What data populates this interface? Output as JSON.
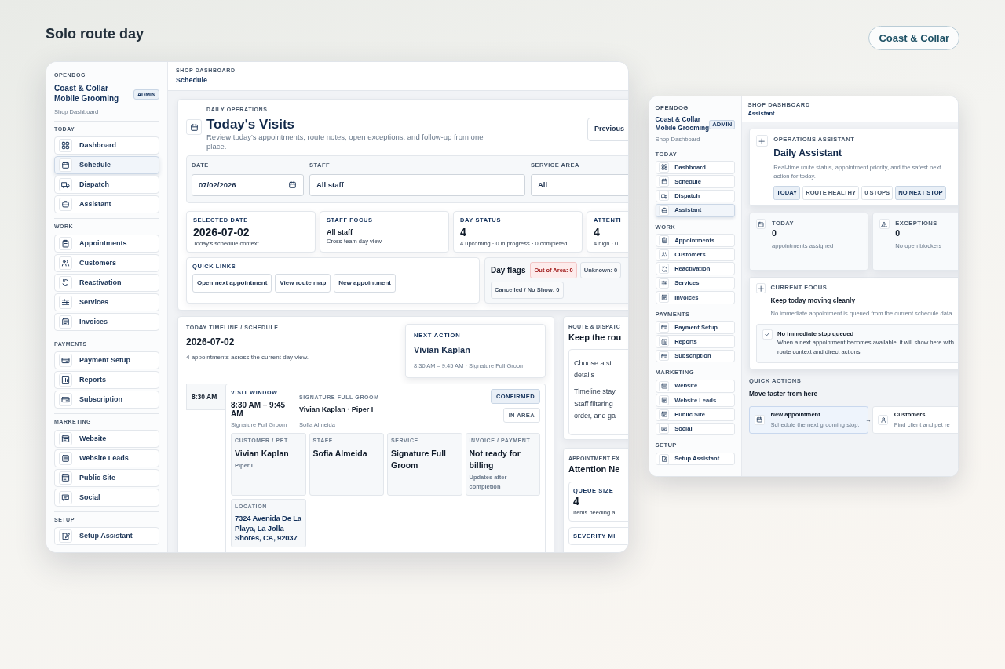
{
  "page": {
    "title": "Solo route day",
    "brand_button": "Coast & Collar"
  },
  "windows": [
    {
      "kind": "schedule",
      "sidebar": {
        "org": "OPENDOG",
        "shop": "Coast & Collar Mobile Grooming",
        "role": "ADMIN",
        "subtitle": "Shop Dashboard",
        "sections": [
          {
            "label": "TODAY",
            "items": [
              {
                "label": "Dashboard",
                "selected": false
              },
              {
                "label": "Schedule",
                "selected": true
              },
              {
                "label": "Dispatch",
                "selected": false
              },
              {
                "label": "Assistant",
                "selected": false
              }
            ]
          },
          {
            "label": "WORK",
            "items": [
              {
                "label": "Appointments",
                "selected": false
              },
              {
                "label": "Customers",
                "selected": false
              },
              {
                "label": "Reactivation",
                "selected": false
              },
              {
                "label": "Services",
                "selected": false
              },
              {
                "label": "Invoices",
                "selected": false
              }
            ]
          },
          {
            "label": "PAYMENTS",
            "items": [
              {
                "label": "Payment Setup",
                "selected": false
              },
              {
                "label": "Reports",
                "selected": false
              },
              {
                "label": "Subscription",
                "selected": false
              }
            ]
          },
          {
            "label": "MARKETING",
            "items": [
              {
                "label": "Website",
                "selected": false
              },
              {
                "label": "Website Leads",
                "selected": false
              },
              {
                "label": "Public Site",
                "selected": false
              },
              {
                "label": "Social",
                "selected": false
              }
            ]
          },
          {
            "label": "SETUP",
            "items": [
              {
                "label": "Setup Assistant",
                "selected": false
              }
            ]
          }
        ]
      },
      "header": {
        "eyebrow": "SHOP DASHBOARD",
        "title": "Schedule"
      },
      "hero": {
        "eyebrow": "DAILY OPERATIONS",
        "title": "Today's Visits",
        "description": "Review today's appointments, route notes, open exceptions, and follow-up from one place.",
        "button": "Previous"
      },
      "filters": [
        {
          "label": "DATE",
          "kind": "date",
          "value": "07/02/2026"
        },
        {
          "label": "STAFF",
          "kind": "select",
          "value": "All staff"
        },
        {
          "label": "SERVICE AREA",
          "kind": "select",
          "value": "All"
        }
      ],
      "stats": [
        {
          "label": "SELECTED DATE",
          "kind": "number",
          "value": "2026-07-02",
          "note": "Today's schedule context"
        },
        {
          "label": "STAFF FOCUS",
          "kind": "text",
          "value": "All staff",
          "note": "Cross-team day view"
        },
        {
          "label": "DAY STATUS",
          "kind": "number",
          "value": "4",
          "note": "4 upcoming · 0 in progress · 0 completed"
        },
        {
          "label": "ATTENTI",
          "kind": "number",
          "value": "4",
          "note": "4 high · 0"
        }
      ],
      "quick_links": {
        "label": "QUICK LINKS",
        "links": [
          "Open next appointment",
          "View route map",
          "New appointment"
        ]
      },
      "day_flags": {
        "label": "Day flags",
        "flags": [
          {
            "text": "Out of Area: 0",
            "alert": true
          },
          {
            "text": "Unknown: 0",
            "alert": false
          },
          {
            "text": "Cancelled / No Show: 0",
            "alert": false
          }
        ]
      },
      "timeline": {
        "eyebrow": "TODAY TIMELINE / SCHEDULE",
        "date": "2026-07-02",
        "summary": "4 appointments across the current day view.",
        "next_action": {
          "label": "NEXT ACTION",
          "name": "Vivian Kaplan",
          "detail": "8:30 AM – 9:45 AM · Signature Full Groom"
        },
        "appointments": [
          {
            "time": "8:30 AM",
            "window_label": "VISIT WINDOW",
            "window": "8:30 AM – 9:45 AM",
            "service": "Signature Full Groom",
            "service_label": "SIGNATURE FULL GROOM",
            "client": "Vivian Kaplan · Piper I",
            "staff": "Sofia Almeida",
            "badges": [
              {
                "text": "CONFIRMED",
                "highlighted": true
              },
              {
                "text": "IN AREA",
                "highlighted": false
              }
            ],
            "tiles": [
              {
                "label": "CUSTOMER / PET",
                "value": "Vivian Kaplan",
                "note": "Piper I"
              },
              {
                "label": "STAFF",
                "value": "Sofia Almeida"
              },
              {
                "label": "SERVICE",
                "value": "Signature Full Groom"
              },
              {
                "label": "INVOICE / PAYMENT",
                "value": "Not ready for billing",
                "note": "Updates after completion"
              },
              {
                "label": "LOCATION",
                "value": "7324 Avenida De La Playa, La Jolla Shores, CA, 92037"
              }
            ]
          }
        ]
      },
      "route_panel": {
        "eyebrow": "ROUTE & DISPATC",
        "title": "Keep the rou",
        "paragraphs": [
          [
            "Choose a st",
            "details"
          ],
          [
            "Timeline stay",
            "Staff filtering",
            "order, and ga"
          ]
        ]
      },
      "attention": {
        "eyebrow": "APPOINTMENT EX",
        "title": "Attention Ne",
        "cards": [
          {
            "label": "QUEUE SIZE",
            "value": "4",
            "note": "Items needing a"
          },
          {
            "label": "SEVERITY MI"
          }
        ]
      }
    },
    {
      "kind": "assistant",
      "sidebar": {
        "org": "OPENDOG",
        "shop": "Coast & Collar Mobile Grooming",
        "role": "ADMIN",
        "subtitle": "Shop Dashboard",
        "sections": [
          {
            "label": "TODAY",
            "items": [
              {
                "label": "Dashboard",
                "selected": false
              },
              {
                "label": "Schedule",
                "selected": false
              },
              {
                "label": "Dispatch",
                "selected": false
              },
              {
                "label": "Assistant",
                "selected": true
              }
            ]
          },
          {
            "label": "WORK",
            "items": [
              {
                "label": "Appointments",
                "selected": false
              },
              {
                "label": "Customers",
                "selected": false
              },
              {
                "label": "Reactivation",
                "selected": false
              },
              {
                "label": "Services",
                "selected": false
              },
              {
                "label": "Invoices",
                "selected": false
              }
            ]
          },
          {
            "label": "PAYMENTS",
            "items": [
              {
                "label": "Payment Setup",
                "selected": false
              },
              {
                "label": "Reports",
                "selected": false
              },
              {
                "label": "Subscription",
                "selected": false
              }
            ]
          },
          {
            "label": "MARKETING",
            "items": [
              {
                "label": "Website",
                "selected": false
              },
              {
                "label": "Website Leads",
                "selected": false
              },
              {
                "label": "Public Site",
                "selected": false
              },
              {
                "label": "Social",
                "selected": false
              }
            ]
          },
          {
            "label": "SETUP",
            "items": [
              {
                "label": "Setup Assistant",
                "selected": false
              }
            ]
          }
        ]
      },
      "header": {
        "eyebrow": "SHOP DASHBOARD",
        "title": "Assistant"
      },
      "hero": {
        "eyebrow": "OPERATIONS ASSISTANT",
        "title": "Daily Assistant",
        "description": "Real-time route status, appointment priority, and the safest next action for today.",
        "chips": [
          {
            "text": "TODAY",
            "highlighted": true
          },
          {
            "text": "ROUTE HEALTHY",
            "highlighted": false
          },
          {
            "text": "0 STOPS",
            "highlighted": false
          },
          {
            "text": "NO NEXT STOP",
            "highlighted": true
          }
        ]
      },
      "stats": [
        {
          "label": "TODAY",
          "value": "0",
          "note": "appointments assigned"
        },
        {
          "label": "EXCEPTIONS",
          "value": "0",
          "note": "No open blockers"
        }
      ],
      "focus": {
        "eyebrow": "CURRENT FOCUS",
        "title": "Keep today moving cleanly",
        "description": "No immediate appointment is queued from the current schedule data.",
        "notice": {
          "title": "No immediate stop queued",
          "text": "When a next appointment becomes available, it will show here with route context and direct actions."
        }
      },
      "quick_actions": {
        "eyebrow": "QUICK ACTIONS",
        "title": "Move faster from here",
        "actions": [
          {
            "title": "New appointment",
            "text": "Schedule the next grooming stop.",
            "arrow": "→",
            "highlighted": true
          },
          {
            "title": "Customers",
            "text": "Find client and pet re",
            "highlighted": false
          }
        ]
      }
    }
  ]
}
